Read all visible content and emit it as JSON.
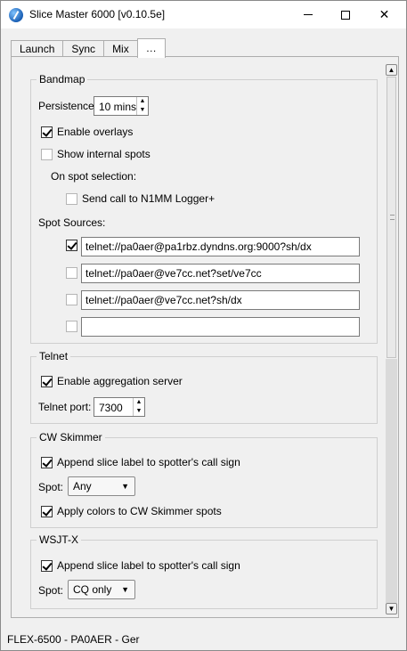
{
  "window": {
    "title": "Slice Master 6000 [v0.10.5e]",
    "icon": "app-logo-icon"
  },
  "tabs": [
    {
      "label": "Launch"
    },
    {
      "label": "Sync"
    },
    {
      "label": "Mix"
    },
    {
      "label": "…"
    }
  ],
  "bandmap": {
    "title": "Bandmap",
    "persistence_label": "Persistence",
    "persistence_value": "10 mins",
    "enable_overlays": {
      "label": "Enable overlays",
      "checked": true
    },
    "show_internal_spots": {
      "label": "Show internal spots",
      "checked": false
    },
    "on_spot_selection_label": "On spot selection:",
    "send_call": {
      "label": "Send call to N1MM Logger+",
      "checked": false
    },
    "spot_sources_label": "Spot Sources:",
    "spot_sources": [
      {
        "checked": true,
        "value": "telnet://pa0aer@pa1rbz.dyndns.org:9000?sh/dx"
      },
      {
        "checked": false,
        "value": "telnet://pa0aer@ve7cc.net?set/ve7cc"
      },
      {
        "checked": false,
        "value": "telnet://pa0aer@ve7cc.net?sh/dx"
      },
      {
        "checked": false,
        "value": ""
      }
    ]
  },
  "telnet": {
    "title": "Telnet",
    "enable_aggregation": {
      "label": "Enable aggregation  server",
      "checked": true
    },
    "port_label": "Telnet port:",
    "port_value": "7300"
  },
  "cw_skimmer": {
    "title": "CW Skimmer",
    "append_label": {
      "label": "Append slice label to spotter's call sign",
      "checked": true
    },
    "spot_label": "Spot:",
    "spot_value": "Any",
    "apply_colors": {
      "label": "Apply colors to CW Skimmer spots",
      "checked": true
    }
  },
  "wsjtx": {
    "title": "WSJT-X",
    "append_label": {
      "label": "Append slice label to spotter's call sign",
      "checked": true
    },
    "spot_label": "Spot:",
    "spot_value": "CQ only"
  },
  "status": {
    "text": "FLEX-6500 - PA0AER - Ger"
  }
}
